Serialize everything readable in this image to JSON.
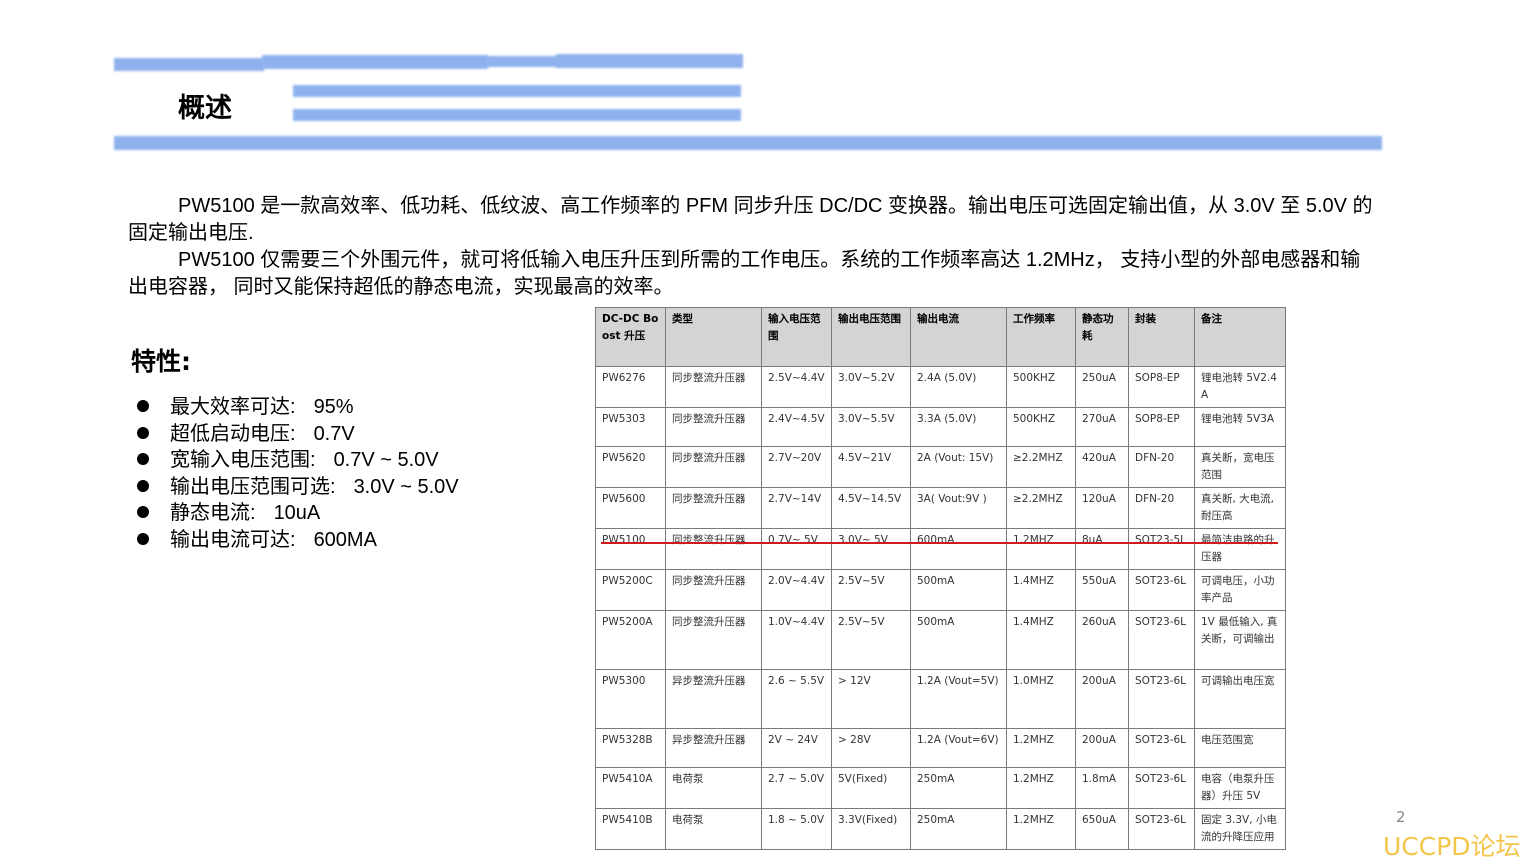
{
  "header": {
    "title": "概述"
  },
  "intro": {
    "paragraphs": [
      "PW5100 是一款高效率、低功耗、低纹波、高工作频率的 PFM 同步升压 DC/DC 变换器。输出电压可选固定输出值，从 3.0V 至 5.0V 的固定输出电压.",
      "PW5100 仅需要三个外围元件，就可将低输入电压升压到所需的工作电压。系统的工作频率高达 1.2MHz， 支持小型的外部电感器和输出电容器， 同时又能保持超低的静态电流，实现最高的效率。"
    ]
  },
  "features": {
    "title": "特性:",
    "items": [
      {
        "label": "最大效率可达:",
        "value": "95%"
      },
      {
        "label": "超低启动电压:",
        "value": "0.7V"
      },
      {
        "label": "宽输入电压范围:",
        "value": "0.7V ~ 5.0V"
      },
      {
        "label": "输出电压范围可选:",
        "value": "3.0V ~ 5.0V"
      },
      {
        "label": "静态电流:",
        "value": "10uA"
      },
      {
        "label": "输出电流可达:",
        "value": "600MA"
      }
    ]
  },
  "table": {
    "headers": [
      "DC-DC Boost 升压",
      "类型",
      "输入电压范围",
      "输出电压范围",
      "输出电流",
      "工作频率",
      "静态功耗",
      "封装",
      "备注"
    ],
    "rows": [
      [
        "PW6276",
        "同步整流升压器",
        "2.5V~4.4V",
        "3.0V~5.2V",
        "2.4A (5.0V)",
        "500KHZ",
        "250uA",
        "SOP8-EP",
        "锂电池转 5V2.4A"
      ],
      [
        "PW5303",
        "同步整流升压器",
        "2.4V~4.5V",
        "3.0V~5.5V",
        "3.3A (5.0V)",
        "500KHZ",
        "270uA",
        "SOP8-EP",
        "锂电池转 5V3A"
      ],
      [
        "PW5620",
        "同步整流升压器",
        "2.7V~20V",
        "4.5V~21V",
        "2A (Vout: 15V)",
        "≥2.2MHZ",
        "420uA",
        "DFN-20",
        "真关断，宽电压范围"
      ],
      [
        "PW5600",
        "同步整流升压器",
        "2.7V~14V",
        "4.5V~14.5V",
        "3A( Vout:9V )",
        "≥2.2MHZ",
        "120uA",
        "DFN-20",
        "真关断, 大电流, 耐压高"
      ],
      [
        "PW5100",
        "同步整流升压器",
        "0.7V~ 5V",
        "3.0V~ 5V",
        "600mA",
        "1.2MHZ",
        "8uA",
        "SOT23-5L",
        "最简洁电路的升压器"
      ],
      [
        "PW5200C",
        "同步整流升压器",
        "2.0V~4.4V",
        "2.5V~5V",
        "500mA",
        "1.4MHZ",
        "550uA",
        "SOT23-6L",
        "可调电压，小功率产品"
      ],
      [
        "PW5200A",
        "同步整流升压器",
        "1.0V~4.4V",
        "2.5V~5V",
        "500mA",
        "1.4MHZ",
        "260uA",
        "SOT23-6L",
        "1V 最低输入, 真关断，可调输出"
      ],
      [
        "PW5300",
        "异步整流升压器",
        "2.6 ~ 5.5V",
        "> 12V",
        "1.2A (Vout=5V)",
        "1.0MHZ",
        "200uA",
        "SOT23-6L",
        "可调输出电压宽"
      ],
      [
        "PW5328B",
        "异步整流升压器",
        "2V ~ 24V",
        "> 28V",
        "1.2A (Vout=6V)",
        "1.2MHZ",
        "200uA",
        "SOT23-6L",
        "电压范围宽"
      ],
      [
        "PW5410A",
        "电荷泵",
        "2.7 ~ 5.0V",
        "5V(Fixed)",
        "250mA",
        "1.2MHZ",
        "1.8mA",
        "SOT23-6L",
        "电容（电泵升压器）升压 5V"
      ],
      [
        "PW5410B",
        "电荷泵",
        "1.8 ~ 5.0V",
        "3.3V(Fixed)",
        "250mA",
        "1.2MHZ",
        "650uA",
        "SOT23-6L",
        "固定 3.3V, 小电流的升降压应用"
      ]
    ],
    "highlight_color": "#d21a1a"
  },
  "footer": {
    "page_number": "2",
    "watermark": "UCCPD论坛"
  }
}
